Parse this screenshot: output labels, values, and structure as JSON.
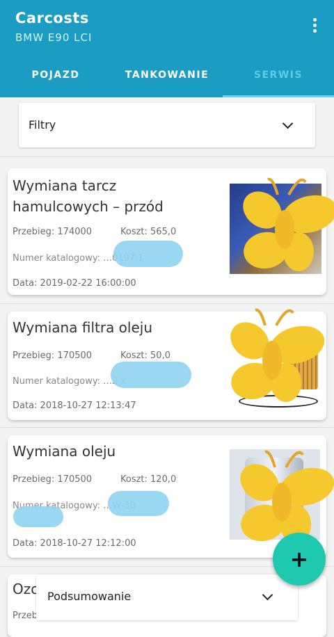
{
  "app": {
    "title": "Carcosts",
    "subtitle": "BMW E90 LCI",
    "accent": "#1b9dc3",
    "menu_icon": "more-vert-icon"
  },
  "tabs": [
    {
      "label": "POJAZD",
      "active": false
    },
    {
      "label": "TANKOWANIE",
      "active": false
    },
    {
      "label": "SERWIS",
      "active": true
    }
  ],
  "filter": {
    "label": "Filtry",
    "icon": "chevron-down-icon"
  },
  "records": [
    {
      "title": "Wymiana tarcz hamulcowych – przód",
      "mileage": "Przebieg: 174000",
      "cost": "Koszt: 565,0",
      "catalog": "Numer katalogowy: …0197.1",
      "date": "Data: 2019-02-22 16:00:00"
    },
    {
      "title": "Wymiana filtra oleju",
      "mileage": "Przebieg: 170500",
      "cost": "Koszt: 50,0",
      "catalog": "Numer katalogowy: …2 x",
      "date": "Data: 2018-10-27 12:13:47"
    },
    {
      "title": "Wymiana oleju",
      "mileage": "Przebieg: 170500",
      "cost": "Koszt: 120,0",
      "catalog": "Numer katalogowy: …W-30",
      "date": "Data: 2018-10-27 12:12:00"
    },
    {
      "title": "Ozo",
      "mileage": "Przeb"
    }
  ],
  "fab": {
    "label": "+",
    "icon": "plus-icon",
    "color": "#1ec9b0"
  },
  "summary": {
    "label": "Podsumowanie",
    "icon": "chevron-down-icon"
  }
}
